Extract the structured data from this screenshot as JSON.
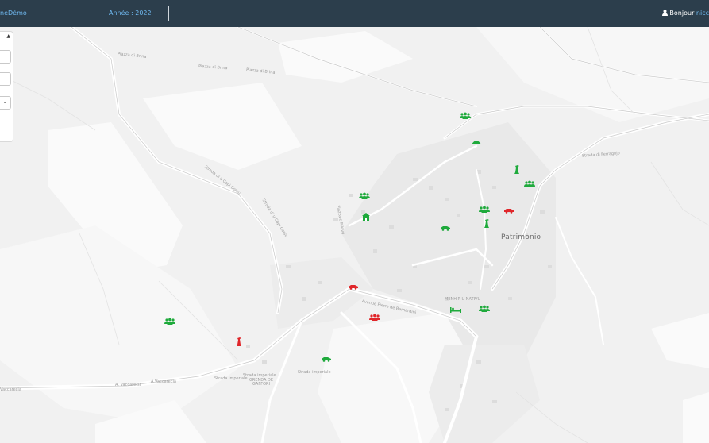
{
  "topbar": {
    "brand": "neDémo",
    "year_label": "Année : 2022",
    "greeting": "Bonjour",
    "username": "nicc"
  },
  "map": {
    "town_label": "Patrimonio",
    "labels": {
      "a_vaccarecia": "A Vaccarecia",
      "a_vaccarecia_left": "Vaccarecia",
      "a_vaccarecia_2": "A. Vaccarecia",
      "strada_capu_corsu": "Strada di u Capi Corsu",
      "strada_capu_corsu_2": "Strada di u Capi Corsu",
      "avenue_bernardini": "Avenue Pierre de Bernardini",
      "piazza_rilevu": "Piazzale Rilevu",
      "strada_ferraghjo": "Strada di Ferraghjo",
      "piazza_brina": "Piazza di Brina",
      "piazza_brina_2": "Piazza di Brina",
      "piazza_brina_3": "Piazza di Brina",
      "grenda": "GRENDA DE GAFFORI",
      "menhir": "MENHIR U NATIVU",
      "strada_imperiale": "Strada imperiale",
      "strada_imperiale_2": "Strada imperiale",
      "strada_imperiale_3": "Strada imperiale"
    },
    "marker_colors": {
      "green": "#1faa3c",
      "red": "#e0262a"
    }
  }
}
